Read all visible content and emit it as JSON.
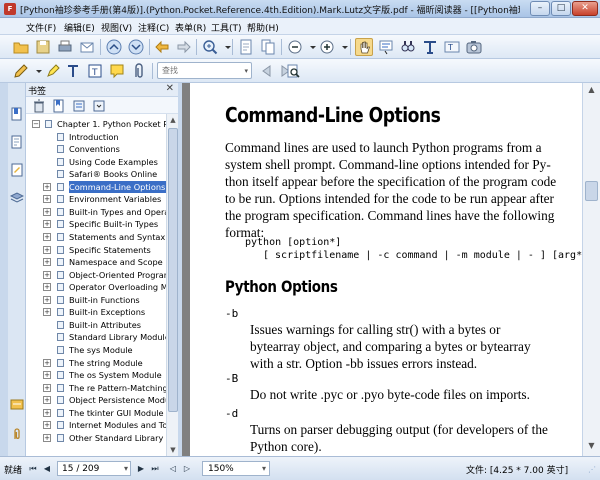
{
  "window": {
    "app_icon_text": "F",
    "title": "[Python袖珍参考手册(第4版)].(Python.Pocket.Reference.4th.Edition).Mark.Lutz文字版.pdf - 福昕阅读器 - [[Python袖珍参考手册(...",
    "min_label": "–",
    "max_label": "□",
    "close_label": "✕"
  },
  "menu": [
    "文件(F)",
    "编辑(E)",
    "视图(V)",
    "注释(C)",
    "表单(R)",
    "工具(T)",
    "帮助(H)"
  ],
  "search": {
    "placeholder": "查找",
    "dropdown": "▾"
  },
  "panel": {
    "title": "书签",
    "close": "✕"
  },
  "scroll": {
    "up": "▲",
    "down": "▼",
    "left": "◀",
    "right": "▶"
  },
  "bookmarks": {
    "chapter": {
      "label": "Chapter 1. Python Pocket R",
      "expander": "−"
    },
    "items": [
      {
        "label": "Introduction",
        "expander": ""
      },
      {
        "label": "Conventions",
        "expander": ""
      },
      {
        "label": "Using Code Examples",
        "expander": ""
      },
      {
        "label": "Safari® Books Online",
        "expander": ""
      },
      {
        "label": "Command-Line Options",
        "expander": "+",
        "selected": true
      },
      {
        "label": "Environment Variables",
        "expander": "+"
      },
      {
        "label": "Built-in Types and Opera",
        "expander": "+"
      },
      {
        "label": "Specific Built-in Types",
        "expander": "+"
      },
      {
        "label": "Statements and Syntax",
        "expander": "+"
      },
      {
        "label": "Specific Statements",
        "expander": "+"
      },
      {
        "label": "Namespace and Scope R",
        "expander": "+"
      },
      {
        "label": "Object-Oriented Progran",
        "expander": "+"
      },
      {
        "label": "Operator Overloading M",
        "expander": "+"
      },
      {
        "label": "Built-in Functions",
        "expander": "+"
      },
      {
        "label": "Built-in Exceptions",
        "expander": "+"
      },
      {
        "label": "Built-in Attributes",
        "expander": ""
      },
      {
        "label": "Standard Library Module",
        "expander": ""
      },
      {
        "label": "The sys Module",
        "expander": ""
      },
      {
        "label": "The string Module",
        "expander": "+"
      },
      {
        "label": "The os System Module",
        "expander": "+"
      },
      {
        "label": "The re Pattern-Matching",
        "expander": "+"
      },
      {
        "label": "Object Persistence Modu",
        "expander": "+"
      },
      {
        "label": "The tkinter GUI Module",
        "expander": "+"
      },
      {
        "label": "Internet Modules and To",
        "expander": "+"
      },
      {
        "label": "Other Standard Library I",
        "expander": "+"
      }
    ]
  },
  "document": {
    "heading": "Command-Line Options",
    "para": [
      "Command lines are used to launch Python programs from a",
      "system shell prompt. Command-line options intended for Py-",
      "thon itself appear before the specification of the program code",
      "to be run. Options intended for the code to be run appear after",
      "the program specification. Command lines have the following",
      "format:"
    ],
    "code_line1": "python [option*]",
    "code_line2": "[ scriptfilename | -c command | -m module | - ] [arg*]",
    "subheading": "Python Options",
    "options": [
      {
        "flag": "-b",
        "lines": [
          "Issues warnings for calling str() with a bytes or",
          "bytearray object, and comparing a bytes or bytearray",
          "with a str. Option -bb issues errors instead."
        ]
      },
      {
        "flag": "-B",
        "lines": [
          "Do not write .pyc or .pyo byte-code files on imports."
        ]
      },
      {
        "flag": "-d",
        "lines": [
          "Turns on parser debugging output (for developers of the",
          "Python core)."
        ]
      }
    ]
  },
  "status": {
    "label": "就绪",
    "page_indicator": "15 / 209",
    "page_dd": "▾",
    "zoom": "150%",
    "zoom_dd": "▾",
    "doc_info": "文件: [4.25 * 7.00 英寸]",
    "grip": "⋰"
  }
}
